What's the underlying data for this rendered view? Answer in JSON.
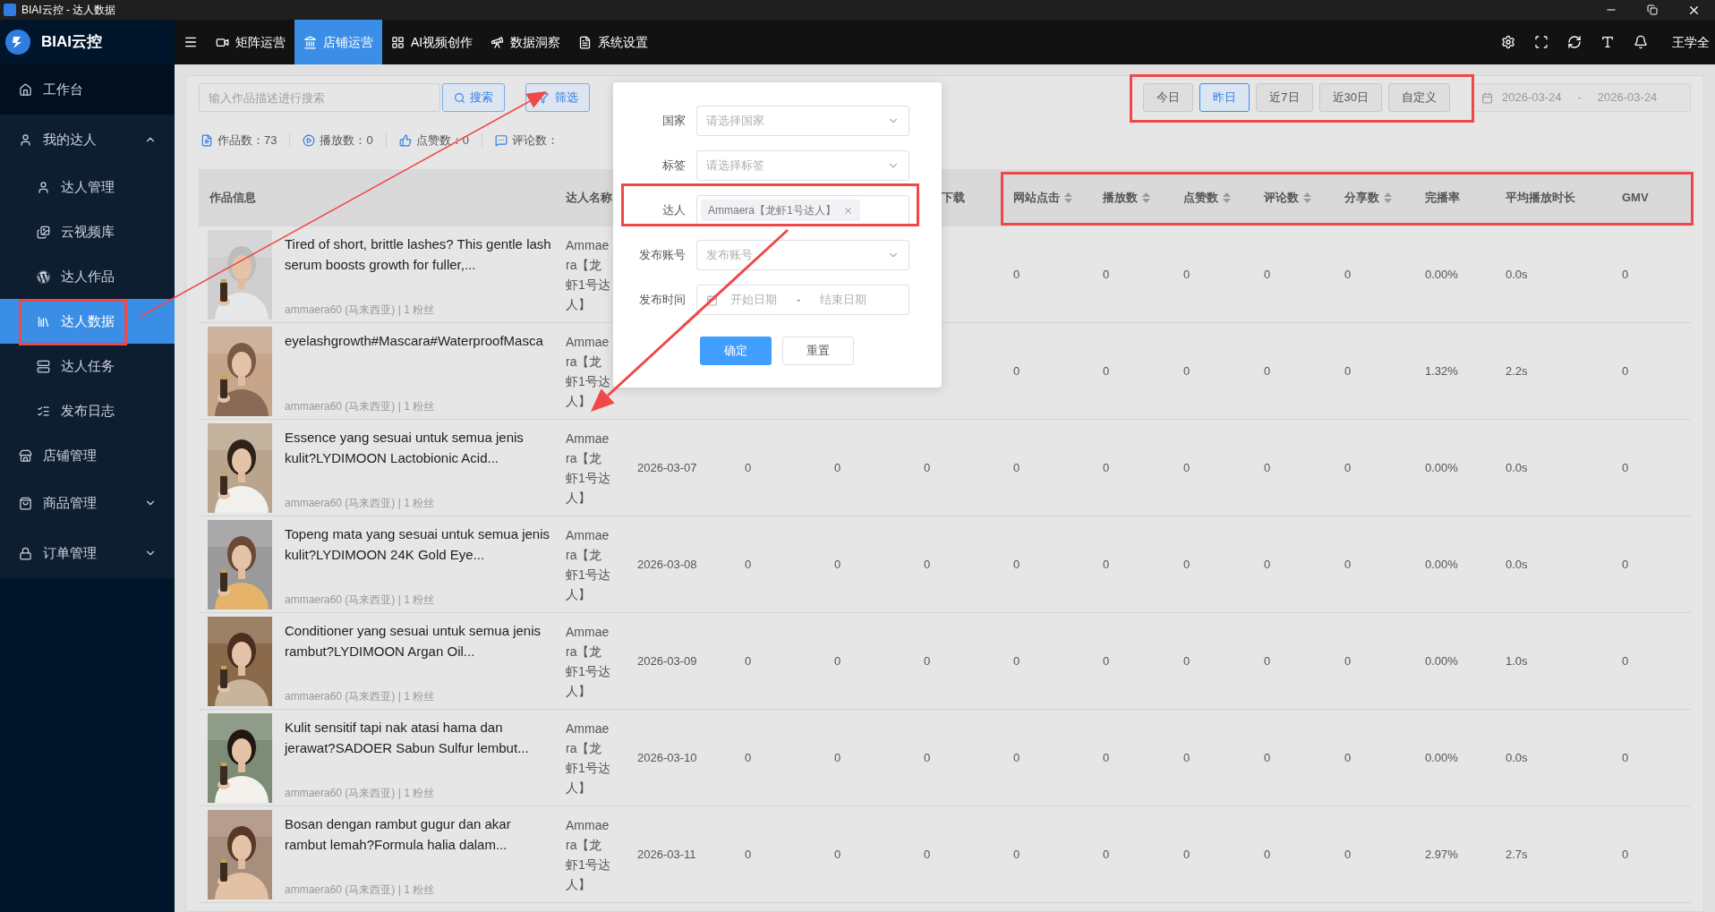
{
  "window": {
    "title": "BIAI云控 - 达人数据"
  },
  "brand": {
    "name": "BIAI云控"
  },
  "sidebar": {
    "items": [
      {
        "label": "工作台",
        "selected": false
      },
      {
        "label": "我的达人",
        "selected": false,
        "expanded": true,
        "children": [
          {
            "label": "达人管理",
            "selected": false
          },
          {
            "label": "云视频库",
            "selected": false
          },
          {
            "label": "达人作品",
            "selected": false
          },
          {
            "label": "达人数据",
            "selected": true
          },
          {
            "label": "达人任务",
            "selected": false
          },
          {
            "label": "发布日志",
            "selected": false
          }
        ]
      },
      {
        "label": "店铺管理",
        "selected": false
      },
      {
        "label": "商品管理",
        "selected": false,
        "expanded": false
      },
      {
        "label": "订单管理",
        "selected": false,
        "expanded": false
      }
    ]
  },
  "top_nav": {
    "tabs": [
      {
        "label": "矩阵运营",
        "selected": false
      },
      {
        "label": "店铺运营",
        "selected": true
      },
      {
        "label": "AI视频创作",
        "selected": false
      },
      {
        "label": "数据洞察",
        "selected": false
      },
      {
        "label": "系统设置",
        "selected": false
      }
    ],
    "user": "王学全"
  },
  "toolbar": {
    "search_placeholder": "输入作品描述进行搜索",
    "search_button": "搜索",
    "filter_button": "筛选",
    "date_presets": [
      {
        "label": "今日",
        "selected": false
      },
      {
        "label": "昨日",
        "selected": true
      },
      {
        "label": "近7日",
        "selected": false
      },
      {
        "label": "近30日",
        "selected": false
      },
      {
        "label": "自定义",
        "selected": false
      }
    ],
    "date_range": {
      "start": "2026-03-24",
      "separator": "-",
      "end": "2026-03-24"
    }
  },
  "stats": [
    "作品数：73",
    "播放数：0",
    "点赞数：0",
    "评论数："
  ],
  "table": {
    "info_column": "作品信息",
    "creator_column": "达人名称",
    "columns": [
      null,
      null,
      null,
      {
        "label": "下载",
        "sortable": false
      },
      {
        "label": "网站点击",
        "sortable": true
      },
      {
        "label": "播放数",
        "sortable": true
      },
      {
        "label": "点赞数",
        "sortable": true
      },
      {
        "label": "评论数",
        "sortable": true
      },
      {
        "label": "分享数",
        "sortable": true
      },
      {
        "label": "完播率",
        "sortable": false
      },
      {
        "label": "平均播放时长",
        "sortable": false
      },
      {
        "label": "GMV",
        "sortable": false
      }
    ],
    "rows": [
      {
        "title": "Tired of short, brittle lashes? This gentle lash serum boosts growth for fuller,...",
        "meta": "ammaera60 (马来西亚) | 1 粉丝",
        "creator": "Ammaera【龙虾1号达人】",
        "cells": [
          "",
          "",
          "",
          "",
          "0",
          "0",
          "0",
          "0",
          "0",
          "0.00%",
          "0.0s",
          "0"
        ]
      },
      {
        "title": "eyelashgrowth#Mascara#WaterproofMasca",
        "meta": "ammaera60 (马来西亚) | 1 粉丝",
        "creator": "Ammaera【龙虾1号达人】",
        "cells": [
          "",
          "",
          "",
          "",
          "0",
          "0",
          "0",
          "0",
          "0",
          "1.32%",
          "2.2s",
          "0"
        ]
      },
      {
        "title": "Essence yang sesuai untuk semua jenis kulit?LYDIMOON Lactobionic Acid...",
        "meta": "ammaera60 (马来西亚) | 1 粉丝",
        "creator": "Ammaera【龙虾1号达人】",
        "cells": [
          "2026-03-07",
          "0",
          "0",
          "0",
          "0",
          "0",
          "0",
          "0",
          "0",
          "0.00%",
          "0.0s",
          "0"
        ]
      },
      {
        "title": "Topeng mata yang sesuai untuk semua jenis kulit?LYDIMOON 24K Gold Eye...",
        "meta": "ammaera60 (马来西亚) | 1 粉丝",
        "creator": "Ammaera【龙虾1号达人】",
        "cells": [
          "2026-03-08",
          "0",
          "0",
          "0",
          "0",
          "0",
          "0",
          "0",
          "0",
          "0.00%",
          "0.0s",
          "0"
        ]
      },
      {
        "title": "Conditioner yang sesuai untuk semua jenis rambut?LYDIMOON Argan Oil...",
        "meta": "ammaera60 (马来西亚) | 1 粉丝",
        "creator": "Ammaera【龙虾1号达人】",
        "cells": [
          "2026-03-09",
          "0",
          "0",
          "0",
          "0",
          "0",
          "0",
          "0",
          "0",
          "0.00%",
          "1.0s",
          "0"
        ]
      },
      {
        "title": "Kulit sensitif tapi nak atasi hama dan jerawat?SADOER Sabun Sulfur lembut...",
        "meta": "ammaera60 (马来西亚) | 1 粉丝",
        "creator": "Ammaera【龙虾1号达人】",
        "cells": [
          "2026-03-10",
          "0",
          "0",
          "0",
          "0",
          "0",
          "0",
          "0",
          "0",
          "0.00%",
          "0.0s",
          "0"
        ]
      },
      {
        "title": "Bosan dengan rambut gugur dan akar rambut lemah?Formula halia dalam...",
        "meta": "ammaera60 (马来西亚) | 1 粉丝",
        "creator": "Ammaera【龙虾1号达人】",
        "cells": [
          "2026-03-11",
          "0",
          "0",
          "0",
          "0",
          "0",
          "0",
          "0",
          "0",
          "2.97%",
          "2.7s",
          "0"
        ]
      }
    ]
  },
  "filter_panel": {
    "fields": [
      {
        "label": "国家",
        "kind": "select",
        "placeholder": "请选择国家"
      },
      {
        "label": "标签",
        "kind": "select",
        "placeholder": "请选择标签"
      },
      {
        "label": "达人",
        "kind": "tags",
        "tags": [
          "Ammaera【龙虾1号达人】"
        ]
      },
      {
        "label": "发布账号",
        "kind": "select",
        "placeholder": "发布账号"
      },
      {
        "label": "发布时间",
        "kind": "daterange",
        "start_placeholder": "开始日期",
        "separator": "-",
        "end_placeholder": "结束日期"
      }
    ],
    "buttons": [
      {
        "label": "确定",
        "primary": true
      },
      {
        "label": "重置",
        "primary": false
      }
    ]
  }
}
